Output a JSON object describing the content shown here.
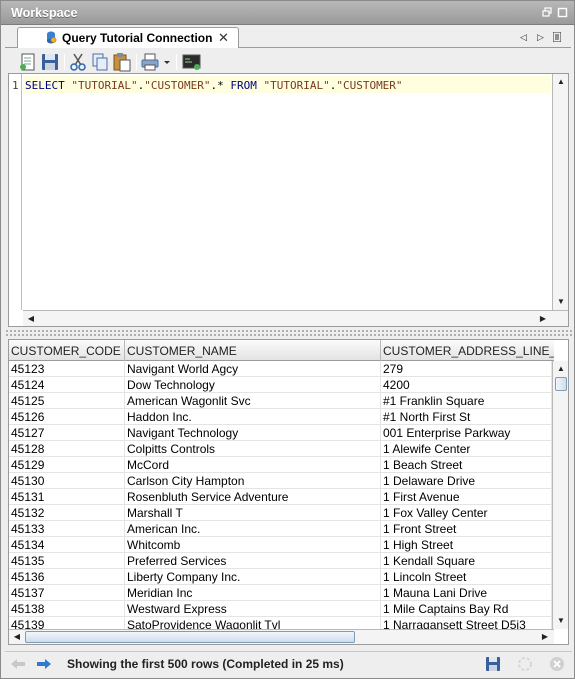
{
  "window": {
    "title": "Workspace"
  },
  "tab": {
    "label": "Query Tutorial Connection",
    "close_glyph": "✕"
  },
  "editor": {
    "line_number": "1",
    "sql": {
      "kw_select": "SELECT",
      "str_schema": "\"TUTORIAL\"",
      "dot1": ".",
      "str_table": "\"CUSTOMER\"",
      "star": ".*",
      "kw_from": "FROM",
      "str_schema2": "\"TUTORIAL\"",
      "dot2": ".",
      "str_table2": "\"CUSTOMER\""
    }
  },
  "results": {
    "columns": [
      "CUSTOMER_CODE",
      "CUSTOMER_NAME",
      "CUSTOMER_ADDRESS_LINE_"
    ],
    "rows": [
      [
        "45123",
        "Navigant World Agcy",
        "279"
      ],
      [
        "45124",
        "Dow Technology",
        "4200"
      ],
      [
        "45125",
        "American Wagonlit Svc",
        "#1 Franklin Square"
      ],
      [
        "45126",
        "Haddon Inc.",
        "#1 North First St"
      ],
      [
        "45127",
        "Navigant Technology",
        "001 Enterprise Parkway"
      ],
      [
        "45128",
        "Colpitts Controls",
        "1 Alewife Center"
      ],
      [
        "45129",
        "McCord",
        "1 Beach Street"
      ],
      [
        "45130",
        "Carlson City Hampton",
        "1 Delaware Drive"
      ],
      [
        "45131",
        "Rosenbluth Service Adventure",
        "1 First Avenue"
      ],
      [
        "45132",
        "Marshall T",
        "1 Fox Valley Center"
      ],
      [
        "45133",
        "American  Inc.",
        "1 Front Street"
      ],
      [
        "45134",
        "Whitcomb",
        "1 High Street"
      ],
      [
        "45135",
        "Preferred Services",
        "1 Kendall Square"
      ],
      [
        "45136",
        "Liberty Company Inc.",
        "1 Lincoln Street"
      ],
      [
        "45137",
        "Meridian Inc",
        "1 Mauna Lani Drive"
      ],
      [
        "45138",
        "Westward Express",
        "1 Mile Captains Bay Rd"
      ],
      [
        "45139",
        "SatoProvidence Wagonlit Tvl",
        "1 Narragansett Street D5i3"
      ]
    ]
  },
  "status": {
    "text": "Showing the first 500 rows (Completed in 25 ms)"
  },
  "icons": {
    "tab_icon": "database-user-icon",
    "toolbar": [
      "new-document-icon",
      "save-icon",
      "cut-icon",
      "copy-icon",
      "paste-icon",
      "print-icon",
      "dropdown-arrow-icon",
      "console-icon"
    ],
    "status": [
      "back-arrow-icon",
      "forward-arrow-icon",
      "save-icon",
      "busy-spinner-icon",
      "cancel-icon"
    ]
  },
  "colors": {
    "titlebar": "#a8a8a8",
    "current_line": "#ffffe0",
    "keyword": "#000080",
    "string": "#7a3a1d",
    "forward_arrow": "#2f7bd4"
  }
}
